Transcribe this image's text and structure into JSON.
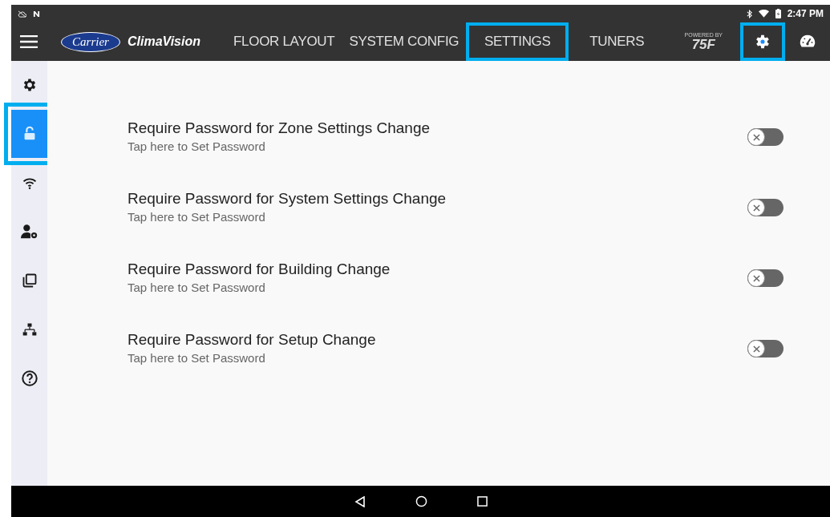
{
  "status_bar": {
    "time": "2:47 PM"
  },
  "app_bar": {
    "brand": {
      "badge": "Carrier",
      "product": "ClimaVision"
    },
    "tabs": [
      {
        "label": "FLOOR LAYOUT",
        "highlighted": false
      },
      {
        "label": "SYSTEM CONFIG",
        "highlighted": false
      },
      {
        "label": "SETTINGS",
        "highlighted": true
      },
      {
        "label": "TUNERS",
        "highlighted": false
      }
    ],
    "powered_by": {
      "caption": "POWERED BY",
      "mark": "75F"
    },
    "actions": [
      {
        "kind": "settings",
        "highlighted": true
      },
      {
        "kind": "dashboard",
        "highlighted": false
      }
    ]
  },
  "sidebar": {
    "items": [
      {
        "kind": "settings",
        "selected": false,
        "highlighted": false
      },
      {
        "kind": "lock",
        "selected": true,
        "highlighted": true
      },
      {
        "kind": "wifi",
        "selected": false,
        "highlighted": false
      },
      {
        "kind": "user-settings",
        "selected": false,
        "highlighted": false
      },
      {
        "kind": "copy",
        "selected": false,
        "highlighted": false
      },
      {
        "kind": "network",
        "selected": false,
        "highlighted": false
      },
      {
        "kind": "help",
        "selected": false,
        "highlighted": false
      }
    ]
  },
  "settings": [
    {
      "title": "Require Password for Zone Settings Change",
      "subtitle": "Tap here to Set Password",
      "on": false
    },
    {
      "title": "Require Password for System Settings Change",
      "subtitle": "Tap here to Set Password",
      "on": false
    },
    {
      "title": "Require Password for Building Change",
      "subtitle": "Tap here to Set Password",
      "on": false
    },
    {
      "title": "Require Password for Setup Change",
      "subtitle": "Tap here to Set Password",
      "on": false
    }
  ]
}
